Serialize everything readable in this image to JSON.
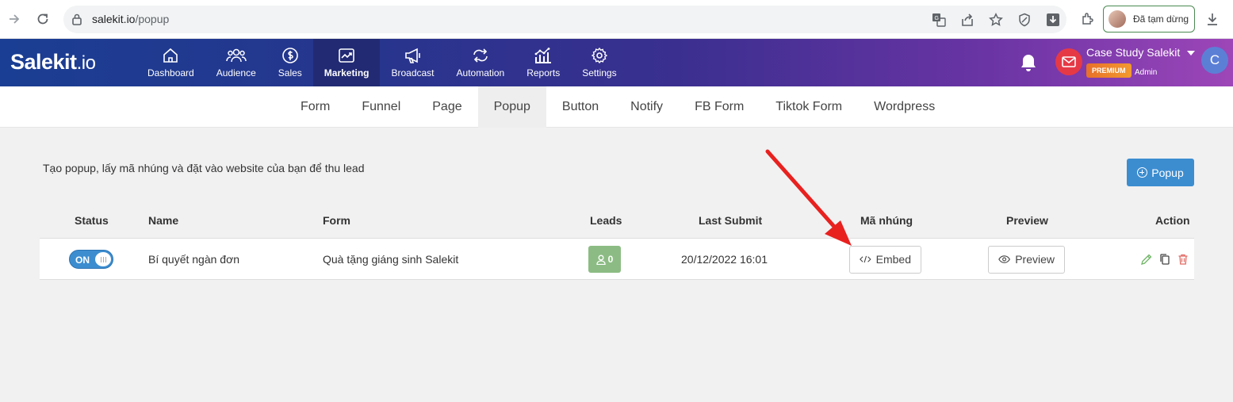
{
  "browser": {
    "url_host": "salekit.io",
    "url_path": "/popup",
    "profile_status": "Đã tạm dừng"
  },
  "app": {
    "logo_main": "Salekit",
    "logo_suffix": ".io",
    "nav": [
      {
        "label": "Dashboard",
        "icon": "home-icon"
      },
      {
        "label": "Audience",
        "icon": "users-icon"
      },
      {
        "label": "Sales",
        "icon": "dollar-icon"
      },
      {
        "label": "Marketing",
        "icon": "chart-icon",
        "active": true
      },
      {
        "label": "Broadcast",
        "icon": "megaphone-icon"
      },
      {
        "label": "Automation",
        "icon": "automation-icon"
      },
      {
        "label": "Reports",
        "icon": "reports-icon"
      },
      {
        "label": "Settings",
        "icon": "gear-icon"
      }
    ],
    "account_name": "Case Study Salekit",
    "plan_badge": "PREMIUM",
    "role": "Admin",
    "avatar_letter": "C"
  },
  "subnav": {
    "tabs": [
      "Form",
      "Funnel",
      "Page",
      "Popup",
      "Button",
      "Notify",
      "FB Form",
      "Tiktok Form",
      "Wordpress"
    ],
    "active": "Popup"
  },
  "page": {
    "description": "Tạo popup, lấy mã nhúng và đặt vào website của bạn để thu lead",
    "add_button": "Popup"
  },
  "table": {
    "headers": {
      "status": "Status",
      "name": "Name",
      "form": "Form",
      "leads": "Leads",
      "last_submit": "Last Submit",
      "embed_code": "Mã nhúng",
      "preview": "Preview",
      "action": "Action"
    },
    "rows": [
      {
        "status": "ON",
        "name": "Bí quyết ngàn đơn",
        "form": "Quà tặng giáng sinh Salekit",
        "leads": "0",
        "last_submit": "20/12/2022 16:01",
        "embed_label": "Embed",
        "preview_label": "Preview"
      }
    ]
  },
  "colors": {
    "primary": "#3c8dd0",
    "leads_badge": "#8cbc84",
    "annotation_arrow": "#e8211f"
  }
}
